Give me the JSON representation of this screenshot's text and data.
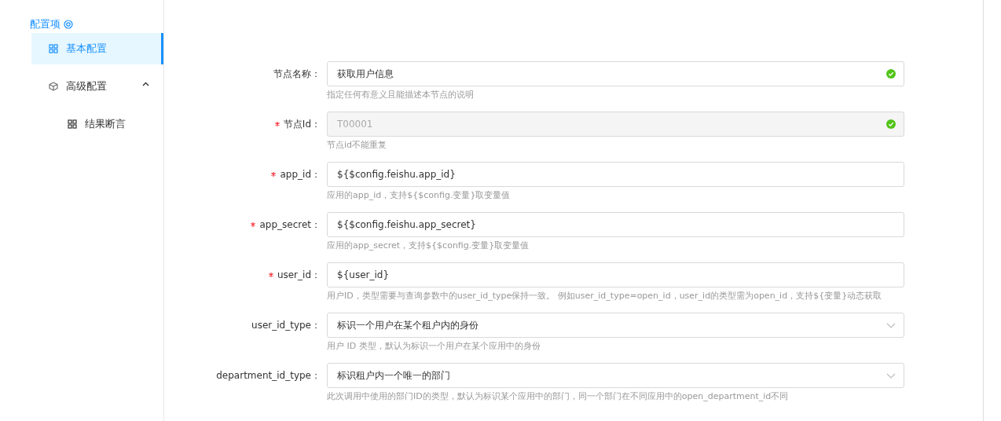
{
  "sidebar": {
    "title": "配置项",
    "items": [
      {
        "label": "基本配置",
        "selected": true
      },
      {
        "label": "高级配置",
        "selected": false,
        "expanded": true,
        "children": [
          {
            "label": "结果断言",
            "selected": false
          }
        ]
      }
    ]
  },
  "form": {
    "fields": [
      {
        "kind": "input",
        "label": "节点名称：",
        "required": false,
        "value": "获取用户信息",
        "disabled": false,
        "valid": true,
        "help": "指定任何有意义且能描述本节点的说明"
      },
      {
        "kind": "input",
        "label": "节点Id：",
        "required": true,
        "value": "T00001",
        "disabled": true,
        "valid": true,
        "help": "节点id不能重复"
      },
      {
        "kind": "input",
        "label": "app_id：",
        "required": true,
        "value": "${$config.feishu.app_id}",
        "disabled": false,
        "valid": false,
        "help": "应用的app_id，支持${$config.变量}取变量值"
      },
      {
        "kind": "input",
        "label": "app_secret：",
        "required": true,
        "value": "${$config.feishu.app_secret}",
        "disabled": false,
        "valid": false,
        "help": "应用的app_secret，支持${$config.变量}取变量值"
      },
      {
        "kind": "input",
        "label": "user_id：",
        "required": true,
        "value": "${user_id}",
        "disabled": false,
        "valid": false,
        "help": "用户ID，类型需要与查询参数中的user_id_type保持一致。 例如user_id_type=open_id，user_id的类型需为open_id，支持${变量}动态获取"
      },
      {
        "kind": "select",
        "label": "user_id_type：",
        "required": false,
        "value": "标识一个用户在某个租户内的身份",
        "disabled": false,
        "valid": false,
        "help": "用户 ID 类型，默认为标识一个用户在某个应用中的身份"
      },
      {
        "kind": "select",
        "label": "department_id_type：",
        "required": false,
        "value": "标识租户内一个唯一的部门",
        "disabled": false,
        "valid": false,
        "help": "此次调用中使用的部门ID的类型，默认为标识某个应用中的部门，同一个部门在不同应用中的open_department_id不同"
      }
    ]
  }
}
